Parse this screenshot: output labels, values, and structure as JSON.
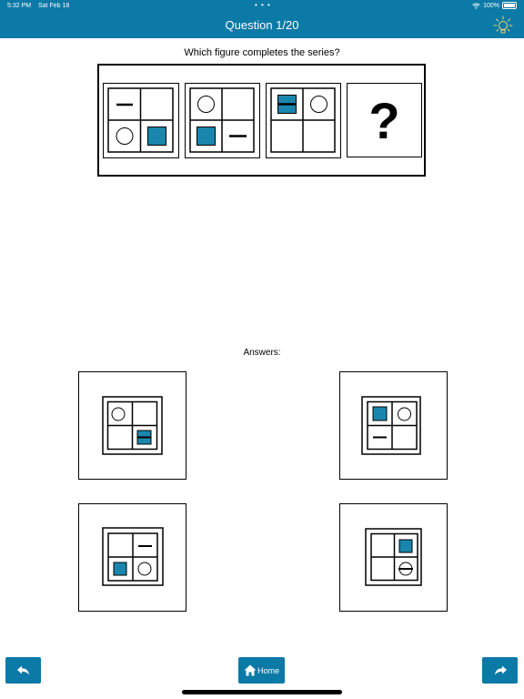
{
  "status": {
    "time": "5:32 PM",
    "date": "Sat Feb 18",
    "dots": "• • •",
    "battery": "100%"
  },
  "header": {
    "title": "Question 1/20",
    "hint_icon": "lightbulb-icon"
  },
  "question": {
    "prompt": "Which figure completes the series?",
    "missing_symbol": "?"
  },
  "answers": {
    "label": "Answers:"
  },
  "footer": {
    "back_icon": "undo-arrow-icon",
    "home_label": "Home",
    "home_icon": "home-icon",
    "forward_icon": "share-arrow-icon"
  },
  "colors": {
    "accent": "#0b7aa6",
    "shape_fill": "#1b86ad"
  }
}
